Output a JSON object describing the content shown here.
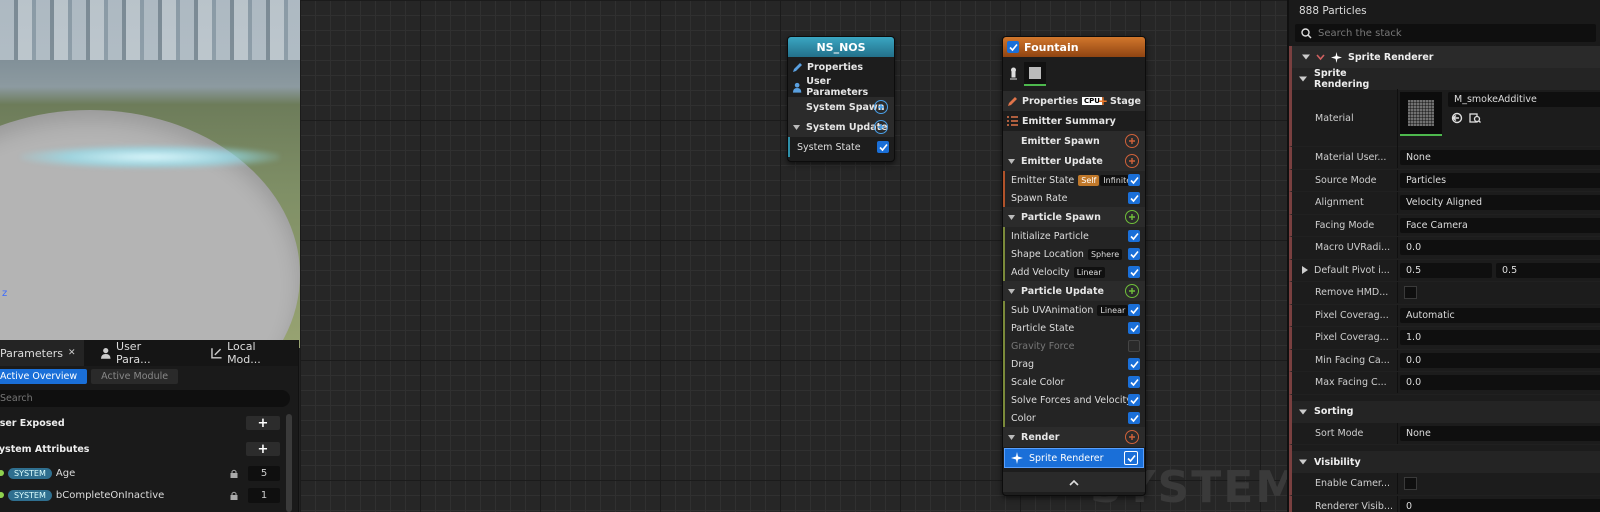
{
  "viewport": {
    "axis_label": "z"
  },
  "graph": {
    "watermark": "SYSTEM",
    "system_node": {
      "title": "NS_NOS",
      "properties": "Properties",
      "user_parameters": "User Parameters",
      "system_spawn": "System Spawn",
      "system_update": "System Update",
      "system_state": "System State"
    },
    "emitter_node": {
      "title": "Fountain",
      "properties": "Properties",
      "sim_target": "CPU",
      "stage_label": "Stage",
      "emitter_summary": "Emitter Summary",
      "emitter_spawn": "Emitter Spawn",
      "emitter_update": "Emitter Update",
      "emitter_state": "Emitter State",
      "emitter_state_tag1": "Self",
      "emitter_state_tag2": "Infinite",
      "spawn_rate": "Spawn Rate",
      "particle_spawn": "Particle Spawn",
      "initialize_particle": "Initialize Particle",
      "shape_location": "Shape Location",
      "shape_location_tag": "Sphere",
      "add_velocity": "Add Velocity",
      "add_velocity_tag": "Linear",
      "particle_update": "Particle Update",
      "sub_uv": "Sub UVAnimation",
      "sub_uv_tag": "Linear",
      "particle_state": "Particle State",
      "gravity_force": "Gravity Force",
      "drag": "Drag",
      "scale_color": "Scale Color",
      "solve_forces": "Solve Forces and Velocity",
      "color": "Color",
      "render": "Render",
      "sprite_renderer": "Sprite Renderer"
    }
  },
  "params_panel": {
    "tabs": [
      {
        "label": "Parameters",
        "close": "✕"
      },
      {
        "label": "User Para..."
      },
      {
        "label": "Local Mod..."
      }
    ],
    "subtabs": [
      "Active Overview",
      "Active Module"
    ],
    "search_placeholder": "Search",
    "user_exposed": "User Exposed",
    "system_attributes": "System Attributes",
    "attributes": [
      {
        "namespace": "SYSTEM",
        "name": "Age",
        "value": "5"
      },
      {
        "namespace": "SYSTEM",
        "name": "bCompleteOnInactive",
        "value": "1"
      }
    ]
  },
  "details": {
    "particle_count": "888 Particles",
    "search_placeholder": "Search the stack",
    "section_title": "Sprite Renderer",
    "rendering_title": "Sprite Rendering",
    "material_label": "Material",
    "material_value": "M_smokeAdditive",
    "rows": [
      {
        "label": "Material User...",
        "value": "None"
      },
      {
        "label": "Source Mode",
        "value": "Particles"
      },
      {
        "label": "Alignment",
        "value": "Velocity Aligned"
      },
      {
        "label": "Facing Mode",
        "value": "Face Camera"
      },
      {
        "label": "Macro UVRadi...",
        "value": "0.0"
      },
      {
        "label": "Default Pivot i...",
        "value": "0.5",
        "value2": "0.5"
      },
      {
        "label": "Remove HMD...",
        "value": ""
      },
      {
        "label": "Pixel Coverag...",
        "value": "Automatic"
      },
      {
        "label": "Pixel Coverag...",
        "value": "1.0"
      },
      {
        "label": "Min Facing Ca...",
        "value": "0.0"
      },
      {
        "label": "Max Facing C...",
        "value": "0.0"
      }
    ],
    "sorting_title": "Sorting",
    "sort_mode_label": "Sort Mode",
    "sort_mode_value": "None",
    "visibility_title": "Visibility",
    "enable_camera_label": "Enable Camer...",
    "renderer_vis_label": "Renderer Visib...",
    "renderer_vis_value": "0"
  },
  "colors": {
    "accent_blue": "#1a6fd8",
    "system_header": "#2e8fa8",
    "emitter_header": "#b8611f",
    "namespace_pill": "#2f6f8f"
  }
}
